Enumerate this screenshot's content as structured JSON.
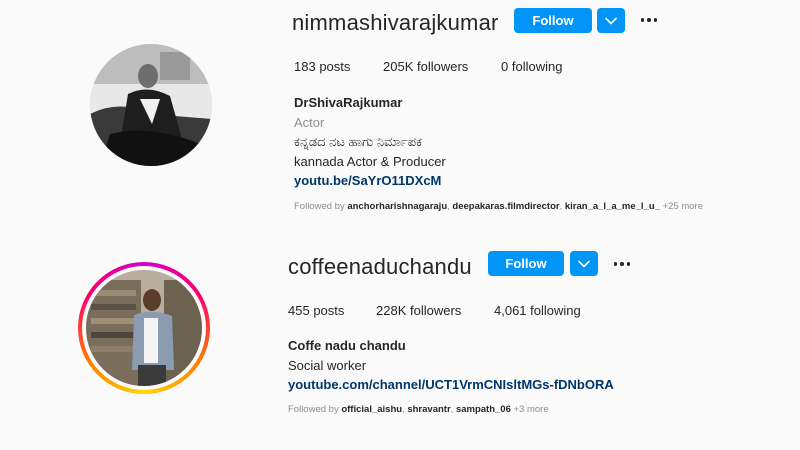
{
  "profiles": [
    {
      "username": "nimmashivarajkumar",
      "follow_label": "Follow",
      "stats": {
        "posts_count": "183",
        "posts_label": "posts",
        "followers_count": "205K",
        "followers_label": "followers",
        "following_count": "0",
        "following_label": "following"
      },
      "full_name": "DrShivaRajkumar",
      "category": "Actor",
      "bio_lines": [
        "ಕನ್ನಡದ ನಟ ಹಾಗು ನಿರ್ಮಾಪಕ",
        "kannada Actor & Producer"
      ],
      "link": "youtu.be/SaYrO11DXcM",
      "followed_by": {
        "prefix": "Followed by",
        "accounts": [
          "anchorharishnagaraju",
          "deepakaras.filmdirector",
          "kiran_a_l_a_me_l_u_"
        ],
        "more": "+25 more"
      }
    },
    {
      "username": "coffeenaduchandu",
      "follow_label": "Follow",
      "stats": {
        "posts_count": "455",
        "posts_label": "posts",
        "followers_count": "228K",
        "followers_label": "followers",
        "following_count": "4,061",
        "following_label": "following"
      },
      "full_name": "Coffe nadu chandu",
      "category": "Social worker",
      "link": "youtube.com/channel/UCT1VrmCNIsltMGs-fDNbORA",
      "followed_by": {
        "prefix": "Followed by",
        "accounts": [
          "official_aishu",
          "shravantr",
          "sampath_06"
        ],
        "more": "+3 more"
      }
    }
  ],
  "colors": {
    "primary_button": "#0095f6",
    "link": "#00376b",
    "secondary_text": "#8e8e8e",
    "story_ring": [
      "#d300c5",
      "#ff7a00",
      "#ffd600"
    ]
  },
  "icons": {
    "dropdown": "chevron-down-icon",
    "more": "more-options-icon"
  }
}
